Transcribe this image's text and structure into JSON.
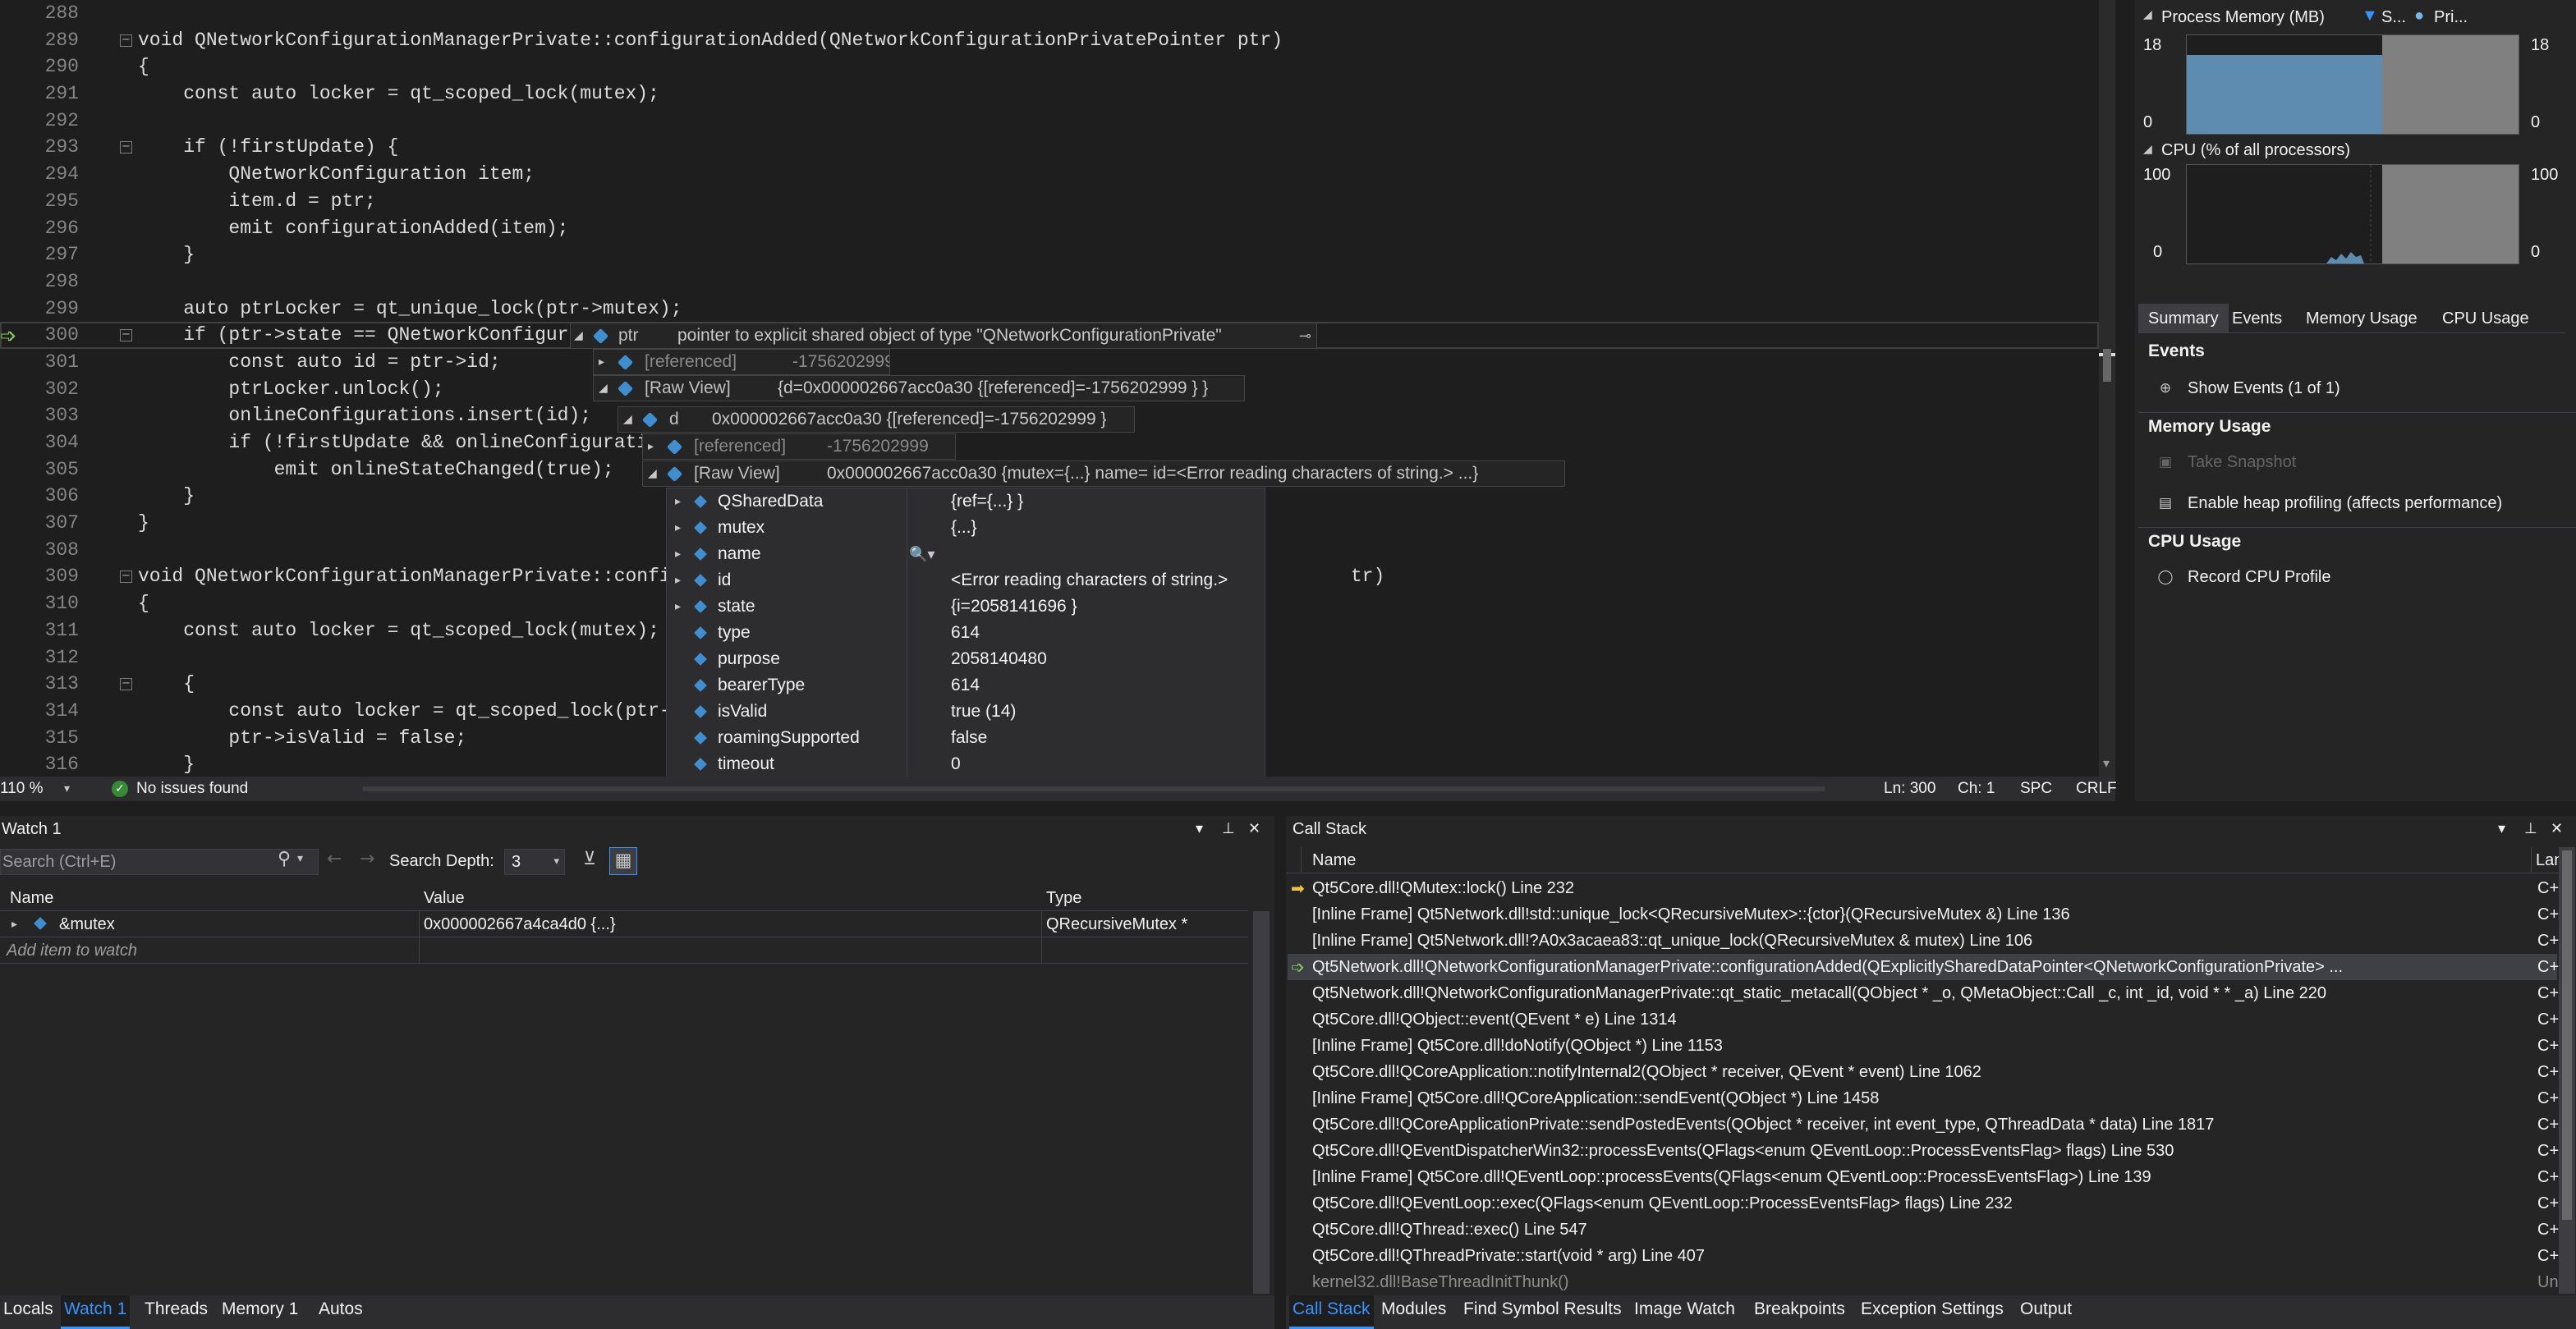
{
  "editor": {
    "lines": [
      {
        "num": "288",
        "text": ""
      },
      {
        "num": "289",
        "text": "void QNetworkConfigurationManagerPrivate::configurationAdded(QNetworkConfigurationPrivatePointer ptr)",
        "fold": true
      },
      {
        "num": "290",
        "text": "{"
      },
      {
        "num": "291",
        "text": "    const auto locker = qt_scoped_lock(mutex);"
      },
      {
        "num": "292",
        "text": ""
      },
      {
        "num": "293",
        "text": "    if (!firstUpdate) {",
        "fold": true
      },
      {
        "num": "294",
        "text": "        QNetworkConfiguration item;"
      },
      {
        "num": "295",
        "text": "        item.d = ptr;"
      },
      {
        "num": "296",
        "text": "        emit configurationAdded(item);"
      },
      {
        "num": "297",
        "text": "    }"
      },
      {
        "num": "298",
        "text": ""
      },
      {
        "num": "299",
        "text": "    auto ptrLocker = qt_unique_lock(ptr->mutex);"
      },
      {
        "num": "300",
        "text": "    if (ptr->state == QNetworkConfigur",
        "fold": true,
        "current": true
      },
      {
        "num": "301",
        "text": "        const auto id = ptr->id;"
      },
      {
        "num": "302",
        "text": "        ptrLocker.unlock();"
      },
      {
        "num": "303",
        "text": "        onlineConfigurations.insert(id);"
      },
      {
        "num": "304",
        "text": "        if (!firstUpdate && onlineConfigurati"
      },
      {
        "num": "305",
        "text": "            emit onlineStateChanged(true);"
      },
      {
        "num": "306",
        "text": "    }"
      },
      {
        "num": "307",
        "text": "}"
      },
      {
        "num": "308",
        "text": ""
      },
      {
        "num": "309",
        "text": "void QNetworkConfigurationManagerPrivate::confi                                                            tr)",
        "fold": true
      },
      {
        "num": "310",
        "text": "{"
      },
      {
        "num": "311",
        "text": "    const auto locker = qt_scoped_lock(mutex);"
      },
      {
        "num": "312",
        "text": ""
      },
      {
        "num": "313",
        "text": "    {",
        "fold": true
      },
      {
        "num": "314",
        "text": "        const auto locker = qt_scoped_lock(ptr-"
      },
      {
        "num": "315",
        "text": "        ptr->isValid = false;"
      },
      {
        "num": "316",
        "text": "    }"
      }
    ]
  },
  "datatip": {
    "ptr": {
      "name": "ptr",
      "value": "pointer to explicit shared object of type \"QNetworkConfigurationPrivate\""
    },
    "ptr_referenced": {
      "name": "[referenced]",
      "value": "-1756202999"
    },
    "ptr_rawview": {
      "name": "[Raw View]",
      "value": "{d=0x000002667acc0a30 {[referenced]=-1756202999 } }"
    },
    "d": {
      "name": "d",
      "value": "0x000002667acc0a30 {[referenced]=-1756202999 }"
    },
    "d_referenced": {
      "name": "[referenced]",
      "value": "-1756202999"
    },
    "d_rawview": {
      "name": "[Raw View]",
      "value": "0x000002667acc0a30 {mutex={...} name= id=<Error reading characters of string.> ...}"
    },
    "members": [
      {
        "name": "QSharedData",
        "value": "{ref={...} }",
        "expandable": true
      },
      {
        "name": "mutex",
        "value": "{...}",
        "expandable": true
      },
      {
        "name": "name",
        "value": "",
        "expandable": true
      },
      {
        "name": "id",
        "value": "<Error reading characters of string.>",
        "expandable": true
      },
      {
        "name": "state",
        "value": "{i=2058141696 }",
        "expandable": true
      },
      {
        "name": "type",
        "value": "614",
        "expandable": false
      },
      {
        "name": "purpose",
        "value": "2058140480",
        "expandable": false
      },
      {
        "name": "bearerType",
        "value": "614",
        "expandable": false
      },
      {
        "name": "isValid",
        "value": "true (14)",
        "expandable": false
      },
      {
        "name": "roamingSupported",
        "value": "false",
        "expandable": false
      },
      {
        "name": "timeout",
        "value": "0",
        "expandable": false
      }
    ]
  },
  "editor_status": {
    "zoom": "110 %",
    "issues": "No issues found",
    "line": "Ln: 300",
    "char": "Ch: 1",
    "spc": "SPC",
    "eol": "CRLF"
  },
  "diagnostics": {
    "process_memory": {
      "title": "Process Memory (MB)",
      "legend_snapshot": "S...",
      "legend_private": "Pri...",
      "y_max": "18",
      "y_min": "0",
      "level": 0.8
    },
    "cpu": {
      "title": "CPU (% of all processors)",
      "y_max": "100",
      "y_min": "0"
    },
    "tabs": [
      "Summary",
      "Events",
      "Memory Usage",
      "CPU Usage"
    ],
    "events_title": "Events",
    "show_events": "Show Events (1 of 1)",
    "memory_title": "Memory Usage",
    "take_snapshot": "Take Snapshot",
    "enable_heap": "Enable heap profiling (affects performance)",
    "cpu_title": "CPU Usage",
    "record_cpu": "Record CPU Profile"
  },
  "watch": {
    "title": "Watch 1",
    "search_placeholder": "Search (Ctrl+E)",
    "search_depth_label": "Search Depth:",
    "search_depth": "3",
    "columns": [
      "Name",
      "Value",
      "Type"
    ],
    "rows": [
      {
        "name": "&mutex",
        "value": "0x000002667a4ca4d0 {...}",
        "type": "QRecursiveMutex *"
      }
    ],
    "add_item": "Add item to watch"
  },
  "callstack": {
    "title": "Call Stack",
    "columns": [
      "Name",
      "Lang"
    ],
    "frames": [
      {
        "name": "Qt5Core.dll!QMutex::lock() Line 232",
        "lang": "C++",
        "marker": "current"
      },
      {
        "name": "[Inline Frame] Qt5Network.dll!std::unique_lock<QRecursiveMutex>::{ctor}(QRecursiveMutex &) Line 136",
        "lang": "C++"
      },
      {
        "name": "[Inline Frame] Qt5Network.dll!?A0x3acaea83::qt_unique_lock(QRecursiveMutex & mutex) Line 106",
        "lang": "C++"
      },
      {
        "name": "Qt5Network.dll!QNetworkConfigurationManagerPrivate::configurationAdded(QExplicitlySharedDataPointer<QNetworkConfigurationPrivate> ...",
        "lang": "C++",
        "marker": "return",
        "selected": true
      },
      {
        "name": "Qt5Network.dll!QNetworkConfigurationManagerPrivate::qt_static_metacall(QObject * _o, QMetaObject::Call _c, int _id, void * * _a) Line 220",
        "lang": "C++"
      },
      {
        "name": "Qt5Core.dll!QObject::event(QEvent * e) Line 1314",
        "lang": "C++"
      },
      {
        "name": "[Inline Frame] Qt5Core.dll!doNotify(QObject *) Line 1153",
        "lang": "C++"
      },
      {
        "name": "Qt5Core.dll!QCoreApplication::notifyInternal2(QObject * receiver, QEvent * event) Line 1062",
        "lang": "C++"
      },
      {
        "name": "[Inline Frame] Qt5Core.dll!QCoreApplication::sendEvent(QObject *) Line 1458",
        "lang": "C++"
      },
      {
        "name": "Qt5Core.dll!QCoreApplicationPrivate::sendPostedEvents(QObject * receiver, int event_type, QThreadData * data) Line 1817",
        "lang": "C++"
      },
      {
        "name": "Qt5Core.dll!QEventDispatcherWin32::processEvents(QFlags<enum QEventLoop::ProcessEventsFlag> flags) Line 530",
        "lang": "C++"
      },
      {
        "name": "[Inline Frame] Qt5Core.dll!QEventLoop::processEvents(QFlags<enum QEventLoop::ProcessEventsFlag>) Line 139",
        "lang": "C++"
      },
      {
        "name": "Qt5Core.dll!QEventLoop::exec(QFlags<enum QEventLoop::ProcessEventsFlag> flags) Line 232",
        "lang": "C++"
      },
      {
        "name": "Qt5Core.dll!QThread::exec() Line 547",
        "lang": "C++"
      },
      {
        "name": "Qt5Core.dll!QThreadPrivate::start(void * arg) Line 407",
        "lang": "C++"
      },
      {
        "name": "kernel32.dll!BaseThreadInitThunk()",
        "lang": "Un...",
        "external": true
      }
    ]
  },
  "bottom_tabs_left": [
    "Locals",
    "Watch 1",
    "Threads",
    "Memory 1",
    "Autos"
  ],
  "bottom_tabs_right": [
    "Call Stack",
    "Modules",
    "Find Symbol Results",
    "Image Watch",
    "Breakpoints",
    "Exception Settings",
    "Output"
  ]
}
